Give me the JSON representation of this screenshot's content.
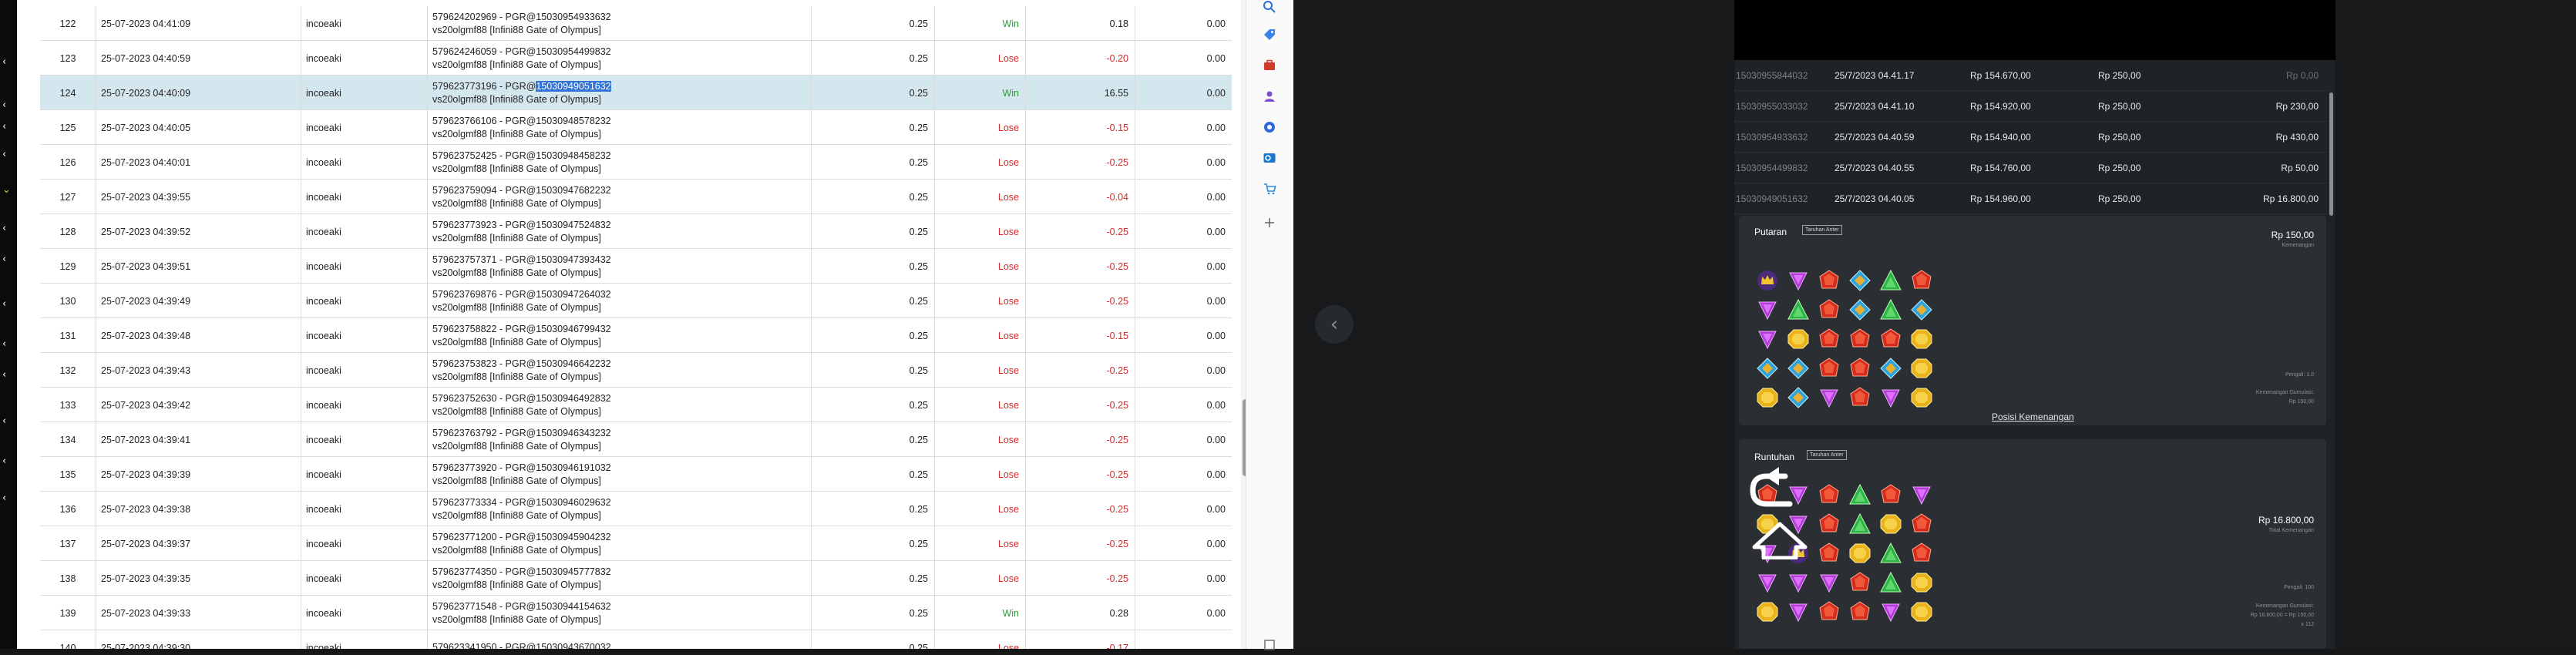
{
  "table": {
    "rows": [
      {
        "no": "122",
        "date": "25-07-2023 04:41:09",
        "user": "incoeaki",
        "t1": "579624202969 - PGR@15030954933632",
        "t2": "vs20olgmf88 [Infini88 Gate of Olympus]",
        "bet": "0.25",
        "result": "Win",
        "win": "0.18",
        "bal": "0.00"
      },
      {
        "no": "123",
        "date": "25-07-2023 04:40:59",
        "user": "incoeaki",
        "t1": "579624246059 - PGR@15030954499832",
        "t2": "vs20olgmf88 [Infini88 Gate of Olympus]",
        "bet": "0.25",
        "result": "Lose",
        "win": "-0.20",
        "bal": "0.00"
      },
      {
        "no": "124",
        "date": "25-07-2023 04:40:09",
        "user": "incoeaki",
        "t1_pre": "579623773196 - PGR@",
        "t1_hl": "15030949051632",
        "t2": "vs20olgmf88 [Infini88 Gate of Olympus]",
        "bet": "0.25",
        "result": "Win",
        "win": "16.55",
        "bal": "0.00"
      },
      {
        "no": "125",
        "date": "25-07-2023 04:40:05",
        "user": "incoeaki",
        "t1": "579623766106 - PGR@15030948578232",
        "t2": "vs20olgmf88 [Infini88 Gate of Olympus]",
        "bet": "0.25",
        "result": "Lose",
        "win": "-0.15",
        "bal": "0.00"
      },
      {
        "no": "126",
        "date": "25-07-2023 04:40:01",
        "user": "incoeaki",
        "t1": "579623752425 - PGR@15030948458232",
        "t2": "vs20olgmf88 [Infini88 Gate of Olympus]",
        "bet": "0.25",
        "result": "Lose",
        "win": "-0.25",
        "bal": "0.00"
      },
      {
        "no": "127",
        "date": "25-07-2023 04:39:55",
        "user": "incoeaki",
        "t1": "579623759094 - PGR@15030947682232",
        "t2": "vs20olgmf88 [Infini88 Gate of Olympus]",
        "bet": "0.25",
        "result": "Lose",
        "win": "-0.04",
        "bal": "0.00"
      },
      {
        "no": "128",
        "date": "25-07-2023 04:39:52",
        "user": "incoeaki",
        "t1": "579623773923 - PGR@15030947524832",
        "t2": "vs20olgmf88 [Infini88 Gate of Olympus]",
        "bet": "0.25",
        "result": "Lose",
        "win": "-0.25",
        "bal": "0.00"
      },
      {
        "no": "129",
        "date": "25-07-2023 04:39:51",
        "user": "incoeaki",
        "t1": "579623757371 - PGR@15030947393432",
        "t2": "vs20olgmf88 [Infini88 Gate of Olympus]",
        "bet": "0.25",
        "result": "Lose",
        "win": "-0.25",
        "bal": "0.00"
      },
      {
        "no": "130",
        "date": "25-07-2023 04:39:49",
        "user": "incoeaki",
        "t1": "579623769876 - PGR@15030947264032",
        "t2": "vs20olgmf88 [Infini88 Gate of Olympus]",
        "bet": "0.25",
        "result": "Lose",
        "win": "-0.25",
        "bal": "0.00"
      },
      {
        "no": "131",
        "date": "25-07-2023 04:39:48",
        "user": "incoeaki",
        "t1": "579623758822 - PGR@15030946799432",
        "t2": "vs20olgmf88 [Infini88 Gate of Olympus]",
        "bet": "0.25",
        "result": "Lose",
        "win": "-0.15",
        "bal": "0.00"
      },
      {
        "no": "132",
        "date": "25-07-2023 04:39:43",
        "user": "incoeaki",
        "t1": "579623753823 - PGR@15030946642232",
        "t2": "vs20olgmf88 [Infini88 Gate of Olympus]",
        "bet": "0.25",
        "result": "Lose",
        "win": "-0.25",
        "bal": "0.00"
      },
      {
        "no": "133",
        "date": "25-07-2023 04:39:42",
        "user": "incoeaki",
        "t1": "579623752630 - PGR@15030946492832",
        "t2": "vs20olgmf88 [Infini88 Gate of Olympus]",
        "bet": "0.25",
        "result": "Lose",
        "win": "-0.25",
        "bal": "0.00"
      },
      {
        "no": "134",
        "date": "25-07-2023 04:39:41",
        "user": "incoeaki",
        "t1": "579623763792 - PGR@15030946343232",
        "t2": "vs20olgmf88 [Infini88 Gate of Olympus]",
        "bet": "0.25",
        "result": "Lose",
        "win": "-0.25",
        "bal": "0.00"
      },
      {
        "no": "135",
        "date": "25-07-2023 04:39:39",
        "user": "incoeaki",
        "t1": "579623773920 - PGR@15030946191032",
        "t2": "vs20olgmf88 [Infini88 Gate of Olympus]",
        "bet": "0.25",
        "result": "Lose",
        "win": "-0.25",
        "bal": "0.00"
      },
      {
        "no": "136",
        "date": "25-07-2023 04:39:38",
        "user": "incoeaki",
        "t1": "579623773334 - PGR@15030946029632",
        "t2": "vs20olgmf88 [Infini88 Gate of Olympus]",
        "bet": "0.25",
        "result": "Lose",
        "win": "-0.25",
        "bal": "0.00"
      },
      {
        "no": "137",
        "date": "25-07-2023 04:39:37",
        "user": "incoeaki",
        "t1": "579623771200 - PGR@15030945904232",
        "t2": "vs20olgmf88 [Infini88 Gate of Olympus]",
        "bet": "0.25",
        "result": "Lose",
        "win": "-0.25",
        "bal": "0.00"
      },
      {
        "no": "138",
        "date": "25-07-2023 04:39:35",
        "user": "incoeaki",
        "t1": "579623774350 - PGR@15030945777832",
        "t2": "vs20olgmf88 [Infini88 Gate of Olympus]",
        "bet": "0.25",
        "result": "Lose",
        "win": "-0.25",
        "bal": "0.00"
      },
      {
        "no": "139",
        "date": "25-07-2023 04:39:33",
        "user": "incoeaki",
        "t1": "579623771548 - PGR@15030944154632",
        "t2": "vs20olgmf88 [Infini88 Gate of Olympus]",
        "bet": "0.25",
        "result": "Win",
        "win": "0.28",
        "bal": "0.00"
      },
      {
        "no": "140",
        "date": "25-07-2023 04:39:30",
        "user": "incoeaki",
        "t1": "579623341950 - PGR@15030943670032",
        "t2": "",
        "bet": "0.25",
        "result": "Lose",
        "win": "-0.17",
        "bal": ""
      }
    ]
  },
  "toolbar": {
    "icons": [
      "search-icon",
      "tag-icon",
      "briefcase-icon",
      "person-icon",
      "circle-icon",
      "outlook-icon",
      "cart-icon",
      "plus-icon"
    ]
  },
  "history": {
    "rows": [
      {
        "id": "15030955844032",
        "date": "25/7/2023 04.41.17",
        "balance": "Rp 154.670,00",
        "bet": "Rp 250,00",
        "win": "Rp 0,00",
        "dim": true
      },
      {
        "id": "15030955033032",
        "date": "25/7/2023 04.41.10",
        "balance": "Rp 154.920,00",
        "bet": "Rp 250,00",
        "win": "Rp 230,00",
        "dim": false
      },
      {
        "id": "15030954933632",
        "date": "25/7/2023 04.40.59",
        "balance": "Rp 154.940,00",
        "bet": "Rp 250,00",
        "win": "Rp 430,00",
        "dim": false
      },
      {
        "id": "15030954499832",
        "date": "25/7/2023 04.40.55",
        "balance": "Rp 154.760,00",
        "bet": "Rp 250,00",
        "win": "Rp 50,00",
        "dim": false
      },
      {
        "id": "15030949051632",
        "date": "25/7/2023 04.40.05",
        "balance": "Rp 154.960,00",
        "bet": "Rp 250,00",
        "win": "Rp 16.800,00",
        "dim": false
      }
    ]
  },
  "spin_card": {
    "title": "Putaran",
    "badge": "Taruhan Anter",
    "amount": "Rp 150,00",
    "amount_sub": "Kemenangan",
    "stat1": "Pengali: 1.0",
    "stat2": "Kemenangan Gumulasi:",
    "stat3": "Rp 150,00",
    "link": "Posisi Kemenangan"
  },
  "tumble_card": {
    "title": "Runtuhan",
    "badge": "Taruhan Anter",
    "amount": "Rp 16.800,00",
    "amount_sub": "Total Kemenangan",
    "stat1": "Pengali: 100",
    "stat2": "Kemenangan Gumulasi:",
    "stat3": "Rp 16.800,00 = Rp 150,00",
    "stat4": "x 112"
  },
  "grid1": [
    [
      "crown",
      "purple",
      "red",
      "blue",
      "green",
      "red"
    ],
    [
      "purple",
      "green",
      "red",
      "blue",
      "green",
      "blue"
    ],
    [
      "purple",
      "yellow",
      "red",
      "red",
      "red",
      "yellow"
    ],
    [
      "blue",
      "blue",
      "red",
      "red",
      "blue",
      "yellow"
    ],
    [
      "yellow",
      "blue",
      "purple",
      "red",
      "purple",
      "yellow"
    ]
  ],
  "grid2": [
    [
      "red",
      "purple",
      "red",
      "green",
      "red",
      "purple"
    ],
    [
      "yellow",
      "purple",
      "red",
      "green",
      "yellow",
      "red"
    ],
    [
      "purple",
      "crown",
      "red",
      "yellow",
      "green",
      "red"
    ],
    [
      "purple",
      "purple",
      "purple",
      "red",
      "green",
      "yellow"
    ],
    [
      "yellow",
      "purple",
      "red",
      "red",
      "purple",
      "yellow"
    ]
  ],
  "colors": {
    "win": "#2f9a3a",
    "lose": "#d42a2a",
    "selected_row": "#d4e7ef",
    "highlight": "#3373d6"
  }
}
